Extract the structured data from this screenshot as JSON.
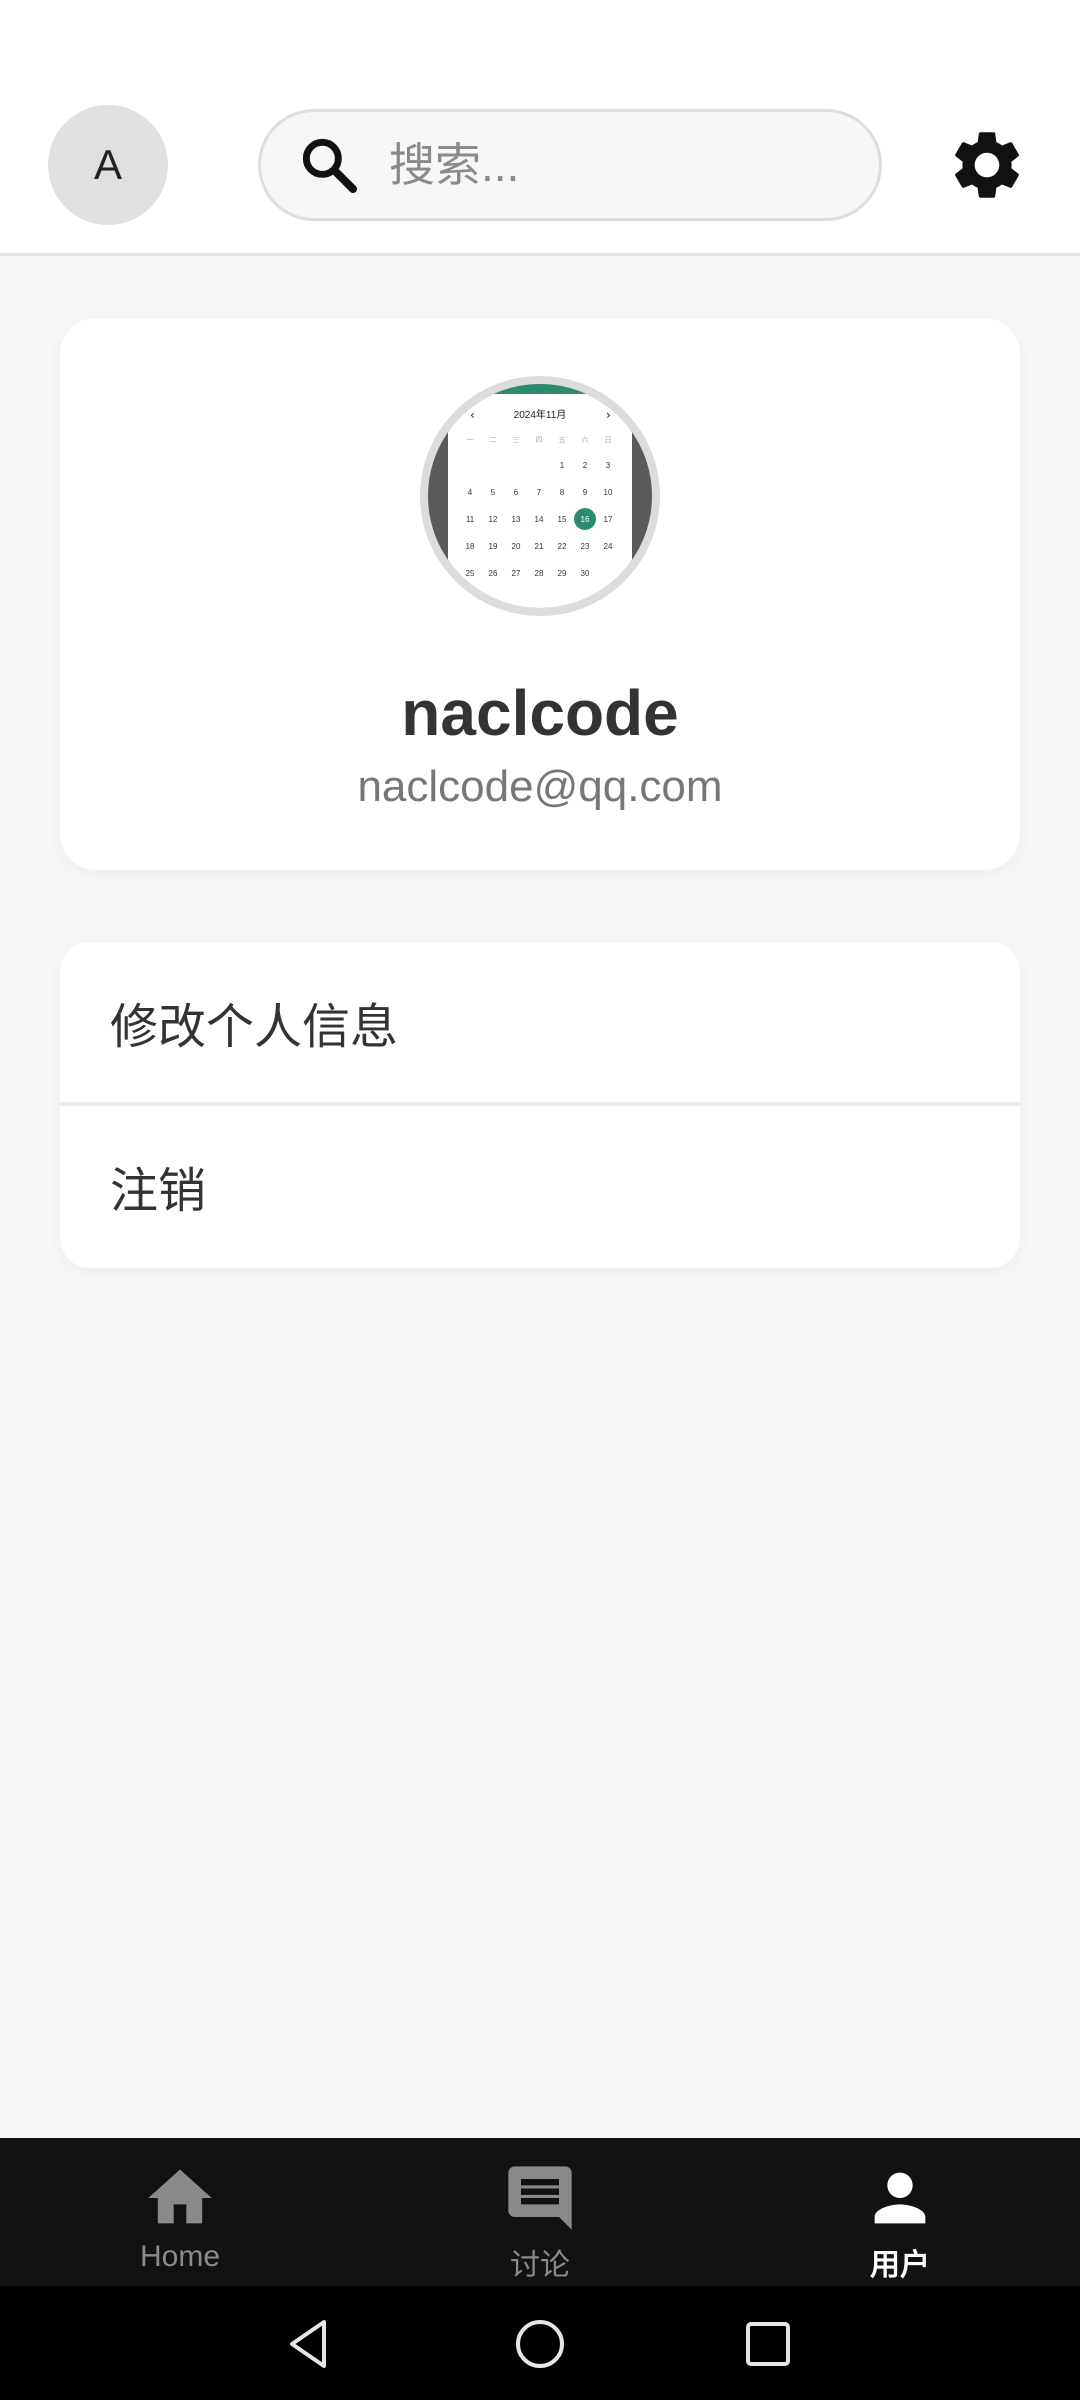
{
  "header": {
    "avatar_initial": "A",
    "search_placeholder": "搜索...",
    "icons": {
      "search": "search-icon",
      "settings": "gear-icon"
    }
  },
  "profile": {
    "username": "naclcode",
    "email": "naclcode@qq.com",
    "avatar_image": {
      "calendar_title": "2024年11月",
      "weekdays": [
        "一",
        "二",
        "三",
        "四",
        "五",
        "六",
        "日"
      ],
      "days": [
        "1",
        "2",
        "3",
        "4",
        "5",
        "6",
        "7",
        "8",
        "9",
        "10",
        "11",
        "12",
        "13",
        "14",
        "15",
        "16",
        "17",
        "18",
        "19",
        "20",
        "21",
        "22",
        "23",
        "24",
        "25",
        "26",
        "27",
        "28",
        "29",
        "30"
      ],
      "selected_day": "16",
      "accent_color": "#2e8b6f"
    }
  },
  "menu": {
    "items": [
      {
        "label": "修改个人信息"
      },
      {
        "label": "注销"
      }
    ]
  },
  "bottom_nav": {
    "items": [
      {
        "label": "Home",
        "icon": "home-icon",
        "active": false
      },
      {
        "label": "讨论",
        "icon": "chat-icon",
        "active": false
      },
      {
        "label": "用户",
        "icon": "person-icon",
        "active": true
      }
    ]
  },
  "system_nav": {
    "icons": [
      "back-icon",
      "home-circle-icon",
      "recent-apps-icon"
    ]
  }
}
